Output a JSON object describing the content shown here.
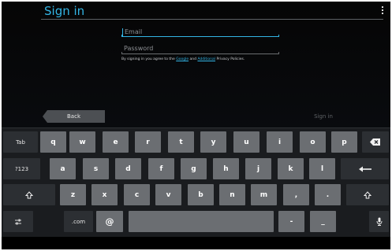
{
  "header": {
    "title": "Sign in"
  },
  "form": {
    "email_placeholder": "Email",
    "password_placeholder": "Password",
    "terms_prefix": "By signing in you agree to the",
    "terms_google": "Google",
    "terms_and": "and",
    "terms_additional": "Additional",
    "terms_suffix": "Privacy Policies."
  },
  "actions": {
    "back_label": "Back",
    "signin_label": "Sign in"
  },
  "keyboard": {
    "tab": "Tab",
    "row1": [
      "q",
      "w",
      "e",
      "r",
      "t",
      "y",
      "u",
      "i",
      "o",
      "p"
    ],
    "numbers": "?123",
    "row2": [
      "a",
      "s",
      "d",
      "f",
      "g",
      "h",
      "j",
      "k",
      "l"
    ],
    "row3": [
      "z",
      "x",
      "c",
      "v",
      "b",
      "n",
      "m",
      ",",
      "."
    ],
    "dotcom": ".com",
    "at": "@",
    "hyphen": "-",
    "underscore": "_"
  }
}
